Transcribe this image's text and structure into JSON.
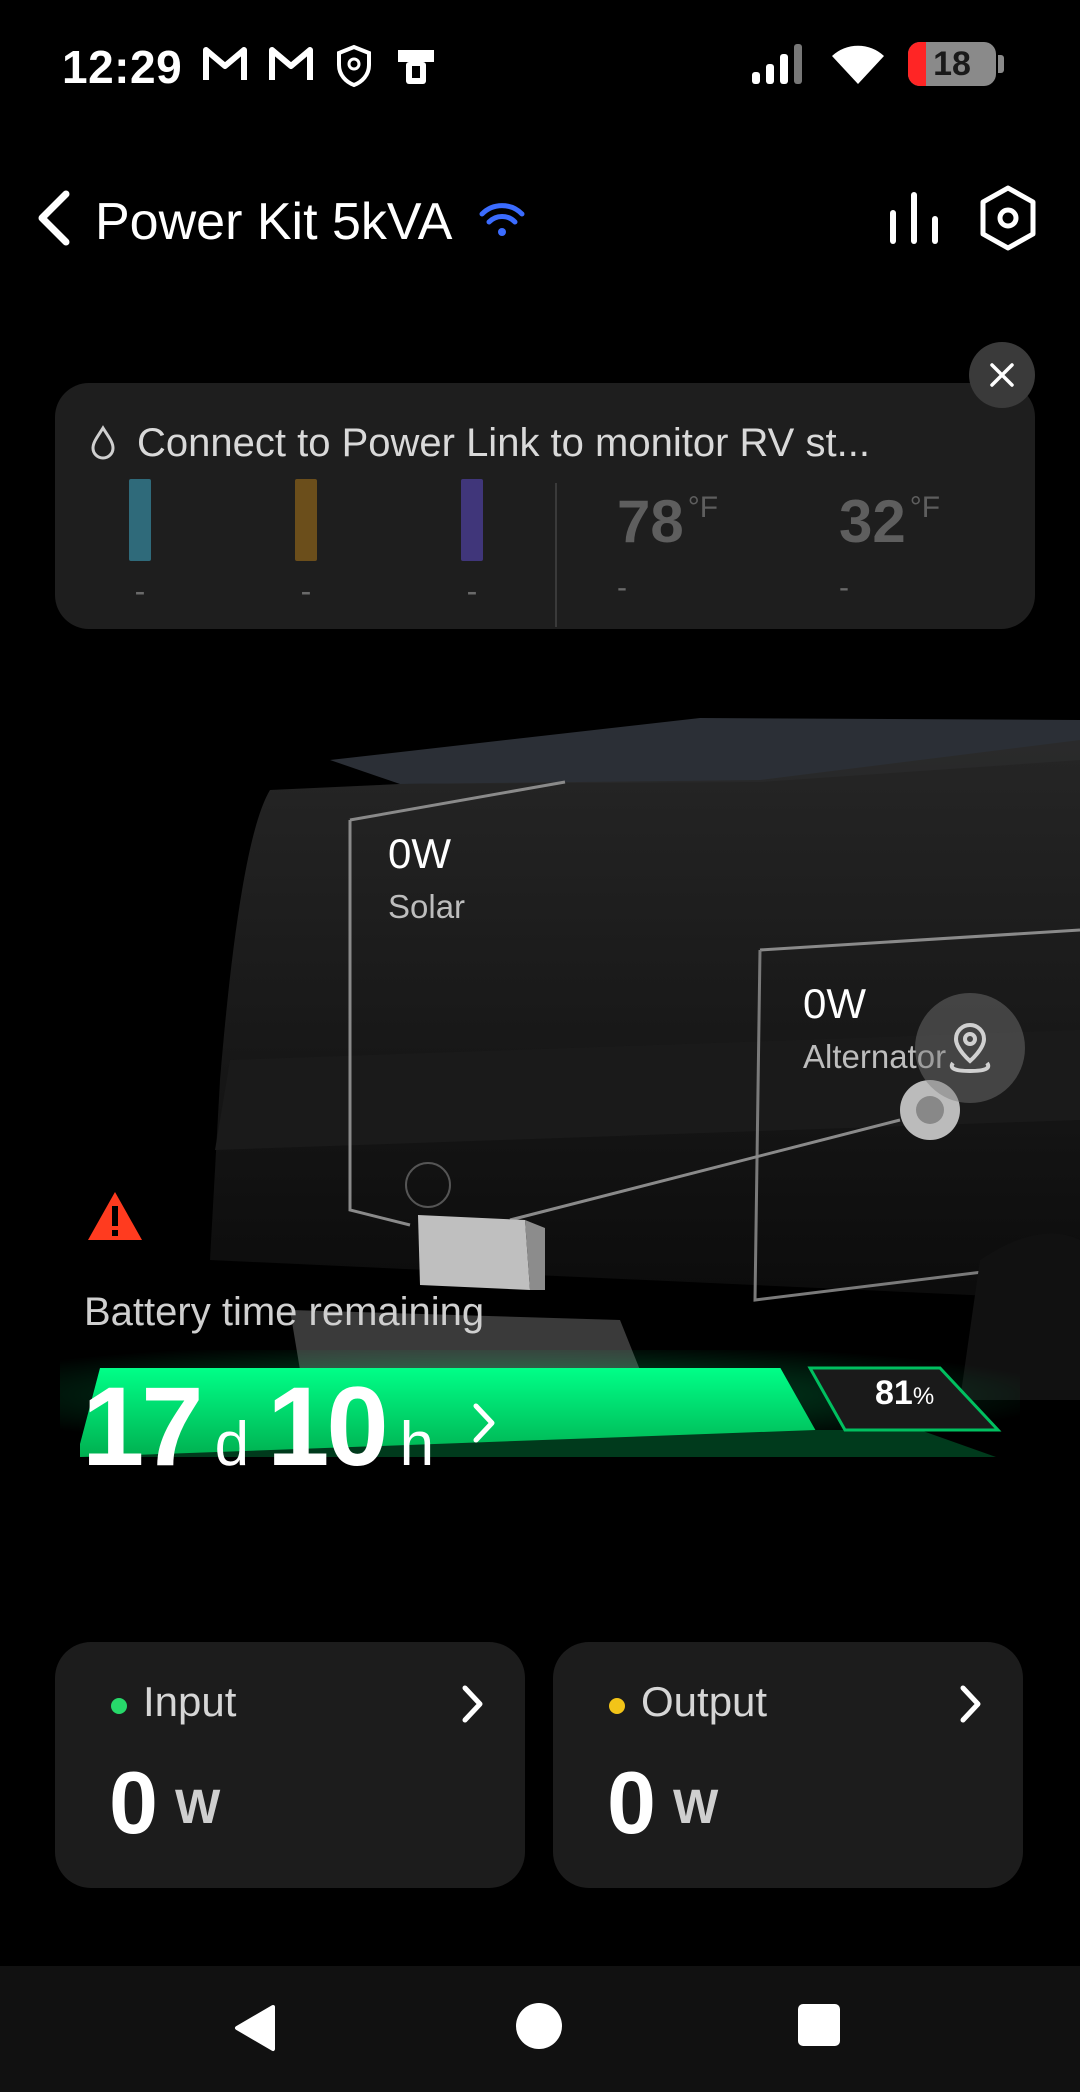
{
  "status_bar": {
    "time": "12:29",
    "battery_level": "18",
    "icons": [
      "gmail-icon",
      "gmail-icon",
      "shield-icon",
      "device-icon",
      "signal-icon",
      "wifi-icon",
      "battery-icon"
    ]
  },
  "header": {
    "title": "Power Kit 5kVA",
    "connection_icon": "wifi-icon",
    "actions": [
      "stats-icon",
      "settings-icon"
    ]
  },
  "notice": {
    "message": "Connect to Power Link to monitor RV st...",
    "tanks": [
      {
        "color": "#3a7a8c",
        "value": "-"
      },
      {
        "color": "#7a5a1e",
        "value": "-"
      },
      {
        "color": "#4a3f8c",
        "value": "-"
      }
    ],
    "temps": [
      {
        "value": "78",
        "unit": "°F",
        "sub": "-"
      },
      {
        "value": "32",
        "unit": "°F",
        "sub": "-"
      }
    ]
  },
  "sources": {
    "solar": {
      "watts": "0W",
      "label": "Solar"
    },
    "alternator": {
      "watts": "0W",
      "label": "Alternator"
    }
  },
  "battery": {
    "caption": "Battery time remaining",
    "days": "17",
    "days_unit": "d",
    "hours": "10",
    "hours_unit": "h",
    "percent": "81",
    "percent_unit": "%",
    "level_fraction": 0.81
  },
  "cards": {
    "input": {
      "label": "Input",
      "value": "0",
      "unit": "W",
      "dot_color": "#27d86a"
    },
    "output": {
      "label": "Output",
      "value": "0",
      "unit": "W",
      "dot_color": "#f2c418"
    }
  },
  "colors": {
    "accent_green": "#00e676",
    "warning_red": "#ff3b1f",
    "wifi_blue": "#3b6cff"
  }
}
